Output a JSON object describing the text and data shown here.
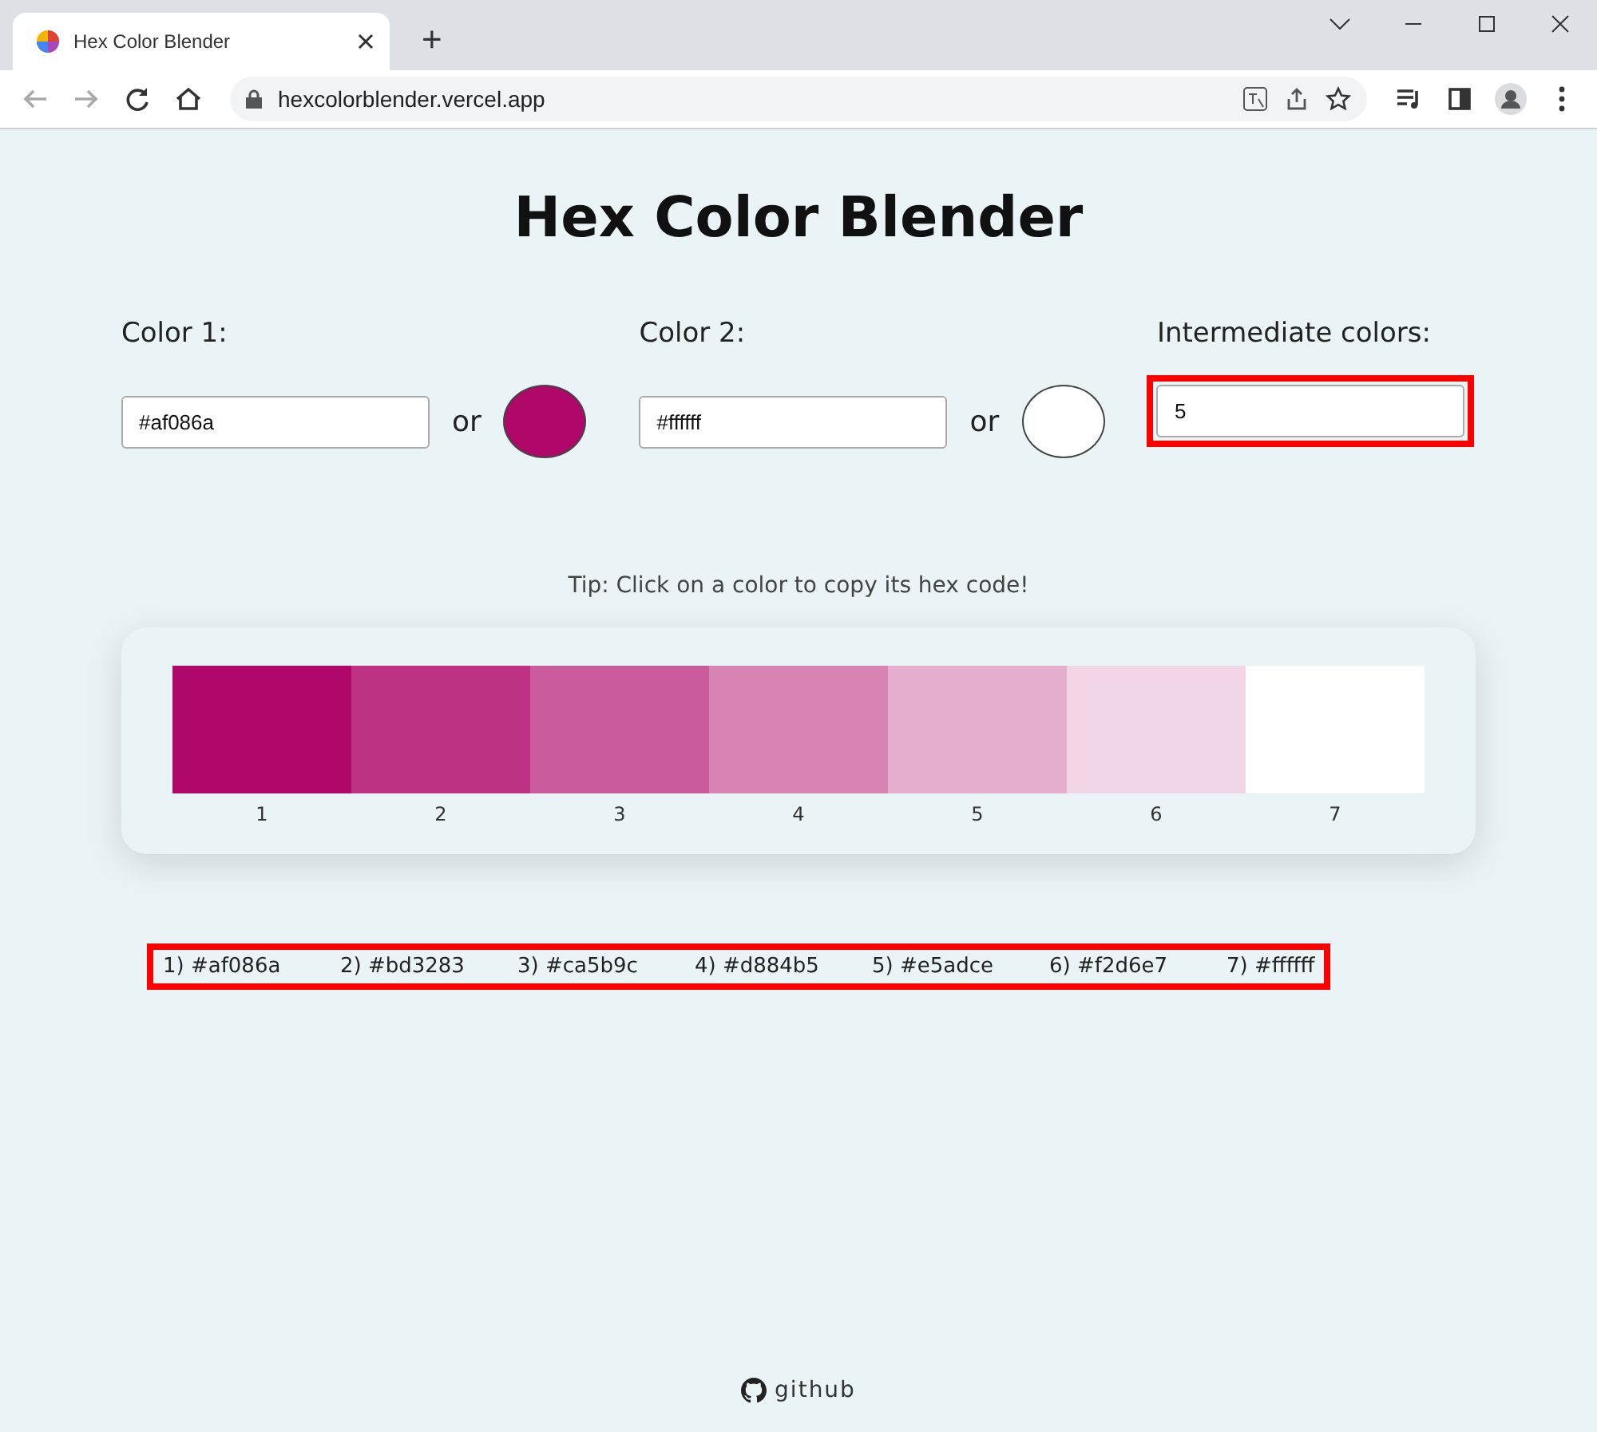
{
  "browser": {
    "tab_title": "Hex Color Blender",
    "new_tab": "+",
    "url": "hexcolorblender.vercel.app"
  },
  "title": "Hex Color Blender",
  "inputs": [
    {
      "kind": "color",
      "label": "Color 1:",
      "value": "#af086a",
      "or": "or",
      "color": "#af086a",
      "highlighted": false
    },
    {
      "kind": "color",
      "label": "Color 2:",
      "value": "#ffffff",
      "or": "or",
      "color": "#ffffff",
      "highlighted": false
    },
    {
      "kind": "count",
      "label": "Intermediate colors:",
      "value": "5",
      "highlighted": true
    }
  ],
  "tip": "Tip: Click on a color to copy its hex code!",
  "swatches": [
    {
      "label": "1",
      "color": "#af086a"
    },
    {
      "label": "2",
      "color": "#bd3283"
    },
    {
      "label": "3",
      "color": "#ca5b9c"
    },
    {
      "label": "4",
      "color": "#d884b5"
    },
    {
      "label": "5",
      "color": "#e5adce"
    },
    {
      "label": "6",
      "color": "#f2d6e7"
    },
    {
      "label": "7",
      "color": "#ffffff"
    }
  ],
  "hex_list": {
    "highlighted": true,
    "items": [
      "1) #af086a",
      "2) #bd3283",
      "3) #ca5b9c",
      "4) #d884b5",
      "5) #e5adce",
      "6) #f2d6e7",
      "7) #ffffff"
    ]
  },
  "footer": {
    "link": "github"
  }
}
